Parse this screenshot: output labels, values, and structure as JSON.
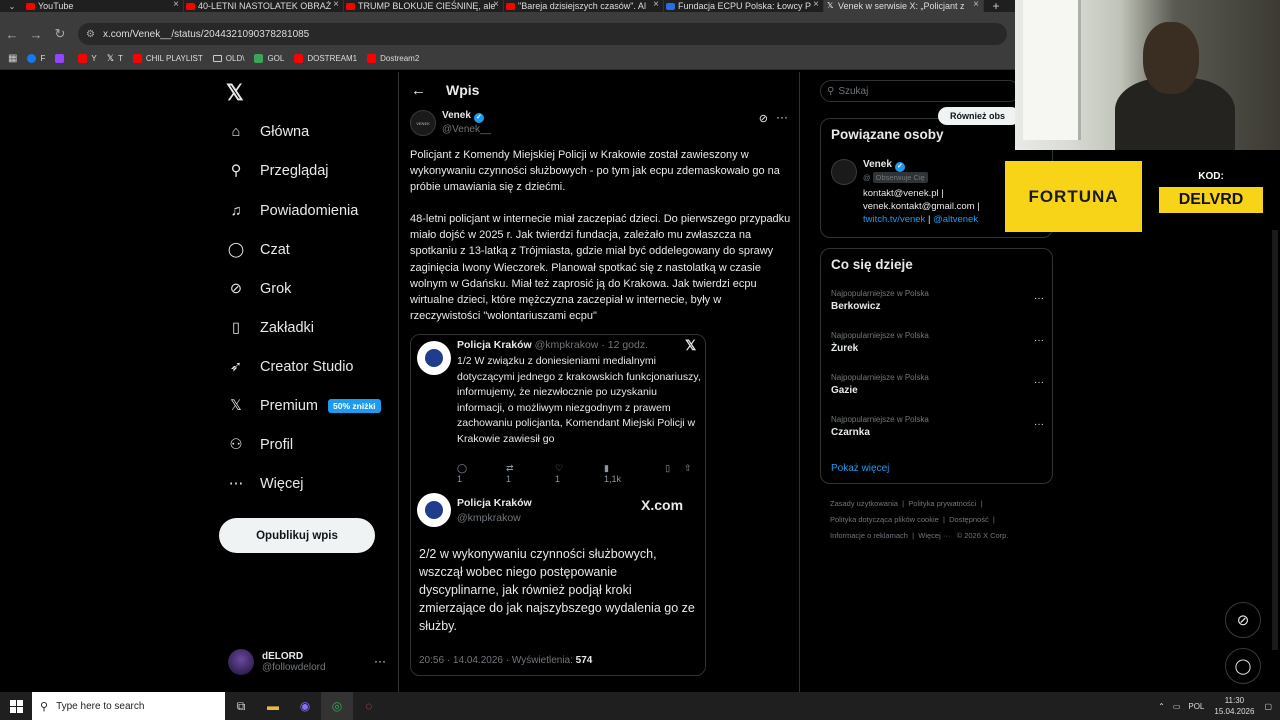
{
  "browser": {
    "tabs": [
      {
        "title": "YouTube",
        "active": false
      },
      {
        "title": "40-LETNI NASTOLATEK OBRAŻ",
        "active": false
      },
      {
        "title": "TRUMP BLOKUJE CIEŚNINĘ, ale",
        "active": false
      },
      {
        "title": "\"Bareja dzisiejszych czasów\". Al",
        "active": false
      },
      {
        "title": "Fundacja ECPU Polska: Łowcy P",
        "active": false
      },
      {
        "title": "Venek w serwisie X: „Policjant z",
        "active": true
      }
    ],
    "url": "x.com/Venek__/status/2044321090378281085",
    "bookmarks": [
      {
        "label": "F",
        "color": "#1877f2"
      },
      {
        "label": "",
        "color": "#9146ff"
      },
      {
        "label": "Y",
        "color": "#ff0000"
      },
      {
        "label": "T",
        "color": "#ffffff"
      },
      {
        "label": "CHIL PLAYLIST",
        "color": "#ff0000"
      },
      {
        "label": "OLD\\",
        "color": "#aaaaaa"
      },
      {
        "label": "GOL",
        "color": "#3aa757"
      },
      {
        "label": "DOSTREAM1",
        "color": "#ff0000"
      },
      {
        "label": "Dostream2",
        "color": "#ff0000"
      }
    ]
  },
  "nav": {
    "items": [
      {
        "label": "Główna",
        "icon": "home-icon",
        "glyph": "⌂"
      },
      {
        "label": "Przeglądaj",
        "icon": "search-icon",
        "glyph": "⚲"
      },
      {
        "label": "Powiadomienia",
        "icon": "bell-icon",
        "glyph": "🔔︎"
      },
      {
        "label": "Czat",
        "icon": "chat-icon",
        "glyph": "◯"
      },
      {
        "label": "Grok",
        "icon": "grok-icon",
        "glyph": "⊘"
      },
      {
        "label": "Zakładki",
        "icon": "bookmark-icon",
        "glyph": "▯"
      },
      {
        "label": "Creator Studio",
        "icon": "rocket-icon",
        "glyph": "➶"
      },
      {
        "label": "Premium",
        "icon": "x-premium-icon",
        "glyph": "𝕏",
        "badge": "50% zniżki"
      },
      {
        "label": "Profil",
        "icon": "profile-icon",
        "glyph": "⚇"
      },
      {
        "label": "Więcej",
        "icon": "more-icon",
        "glyph": "⋯"
      }
    ],
    "post_button": "Opublikuj wpis",
    "account": {
      "name": "dELORD",
      "handle": "@followdelord"
    }
  },
  "main": {
    "header_title": "Wpis",
    "author": {
      "name": "Venek",
      "handle": "@Venek__",
      "avatar_text": "VENEK"
    },
    "paragraph1": "Policjant z Komendy Miejskiej Policji w Krakowie został zawieszony w wykonywaniu czynności służbowych - po tym jak ecpu zdemaskowało go na próbie umawiania się z dziećmi.",
    "paragraph2": "48-letni policjant w internecie miał zaczepiać dzieci. Do pierwszego przypadku miało dojść w 2025 r. Jak twierdzi fundacja, zależało mu zwłaszcza na spotkaniu z 13-latką z Trójmiasta, gdzie miał być oddelegowany do sprawy zaginięcia Iwony Wieczorek. Planował spotkać się z nastolatką w czasie wolnym w Gdańsku. Miał też zaprosić ją do Krakowa. Jak twierdzi ecpu wirtualne dzieci, które mężczyzna zaczepiał w internecie, były w rzeczywistości \"wolontariuszami ecpu\"",
    "embed": {
      "tweet1": {
        "name": "Policja Kraków",
        "handle": "@kmpkrakow",
        "time": "· 12 godz.",
        "text": "1/2 W związku z doniesieniami medialnymi dotyczącymi jednego z krakowskich funkcjonariuszy, informujemy, że niezwłocznie po uzyskaniu informacji, o możliwym niezgodnym z prawem zachowaniu policjanta, Komendant Miejski Policji w Krakowie zawiesił go",
        "replies": "1",
        "reposts": "1",
        "likes": "1",
        "views": "1,1k"
      },
      "tweet2": {
        "name": "Policja Kraków",
        "handle": "@kmpkrakow",
        "brand": "X.com",
        "text": "2/2 w wykonywaniu czynności służbowych, wszczął wobec niego postępowanie dyscyplinarne, jak również podjął kroki zmierzające do jak najszybszego wydalenia go ze służby.",
        "footer": "20:56 · 14.04.2026 · Wyświetlenia:",
        "views": "574"
      }
    }
  },
  "right": {
    "search_placeholder": "Szukaj",
    "related": {
      "title": "Powiązane osoby",
      "name": "Venek",
      "handle": "@",
      "follows_you": "Obserwuje Cię",
      "follow_button": "Również obs",
      "bio_line1": "kontakt@venek.pl |",
      "bio_line2": "venek.kontakt@gmail.com |",
      "bio_link1": "twitch.tv/venek",
      "bio_sep": " | ",
      "bio_link2": "@altvenek"
    },
    "trends": {
      "title": "Co się dzieje",
      "items": [
        {
          "context": "Najpopularniejsze w Polska",
          "name": "Berkowicz"
        },
        {
          "context": "Najpopularniejsze w Polska",
          "name": "Żurek"
        },
        {
          "context": "Najpopularniejsze w Polska",
          "name": "Gazie"
        },
        {
          "context": "Najpopularniejsze w Polska",
          "name": "Czarnka"
        }
      ],
      "show_more": "Pokaż więcej"
    },
    "footer": {
      "l1a": "Zasady użytkowania",
      "l1b": "Polityka prywatności",
      "l2a": "Polityka dotycząca plików cookie",
      "l2b": "Dostępność",
      "l3a": "Informacje o reklamach",
      "l3b": "Więcej ···",
      "l3c": "© 2026 X Corp."
    }
  },
  "overlay": {
    "sponsor": "FORTUNA",
    "code_label": "KOD:",
    "code": "DELVRD"
  },
  "taskbar": {
    "search_placeholder": "Type here to search",
    "lang": "POL",
    "time": "11:30",
    "date": "15.04.2026"
  },
  "colors": {
    "accent": "#1d9bf0",
    "sponsor_yellow": "#f7d417",
    "background": "#000000"
  }
}
